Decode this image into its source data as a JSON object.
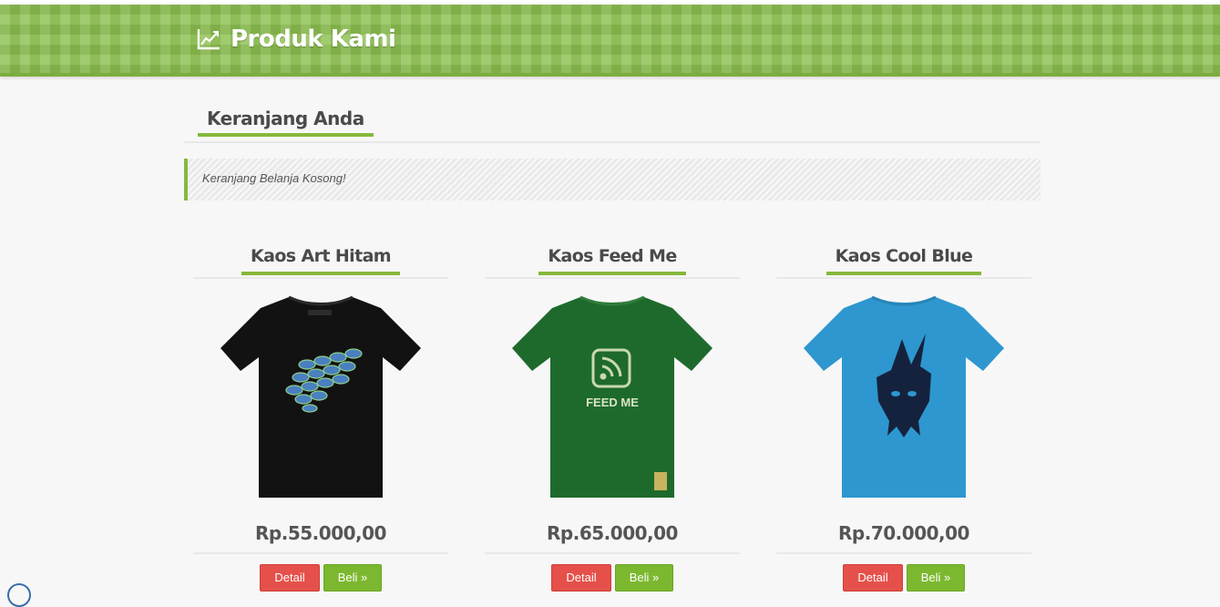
{
  "header": {
    "title": "Produk Kami",
    "icon": "chart-line-icon",
    "bg_color": "#8cc050"
  },
  "cart": {
    "title": "Keranjang Anda",
    "empty_message": "Keranjang Belanja Kosong!"
  },
  "products": [
    {
      "name": "Kaos Art Hitam",
      "price": "Rp.55.000,00",
      "detail_label": "Detail",
      "buy_label": "Beli »",
      "shirt_color": "#121212"
    },
    {
      "name": "Kaos Feed Me",
      "price": "Rp.65.000,00",
      "detail_label": "Detail",
      "buy_label": "Beli »",
      "shirt_color": "#1e6a2c",
      "print_text": "FEED ME"
    },
    {
      "name": "Kaos Cool Blue",
      "price": "Rp.70.000,00",
      "detail_label": "Detail",
      "buy_label": "Beli »",
      "shirt_color": "#2e97cf"
    }
  ],
  "colors": {
    "accent": "#86b83c",
    "detail_button": "#e5504a",
    "buy_button": "#7cb82f"
  }
}
